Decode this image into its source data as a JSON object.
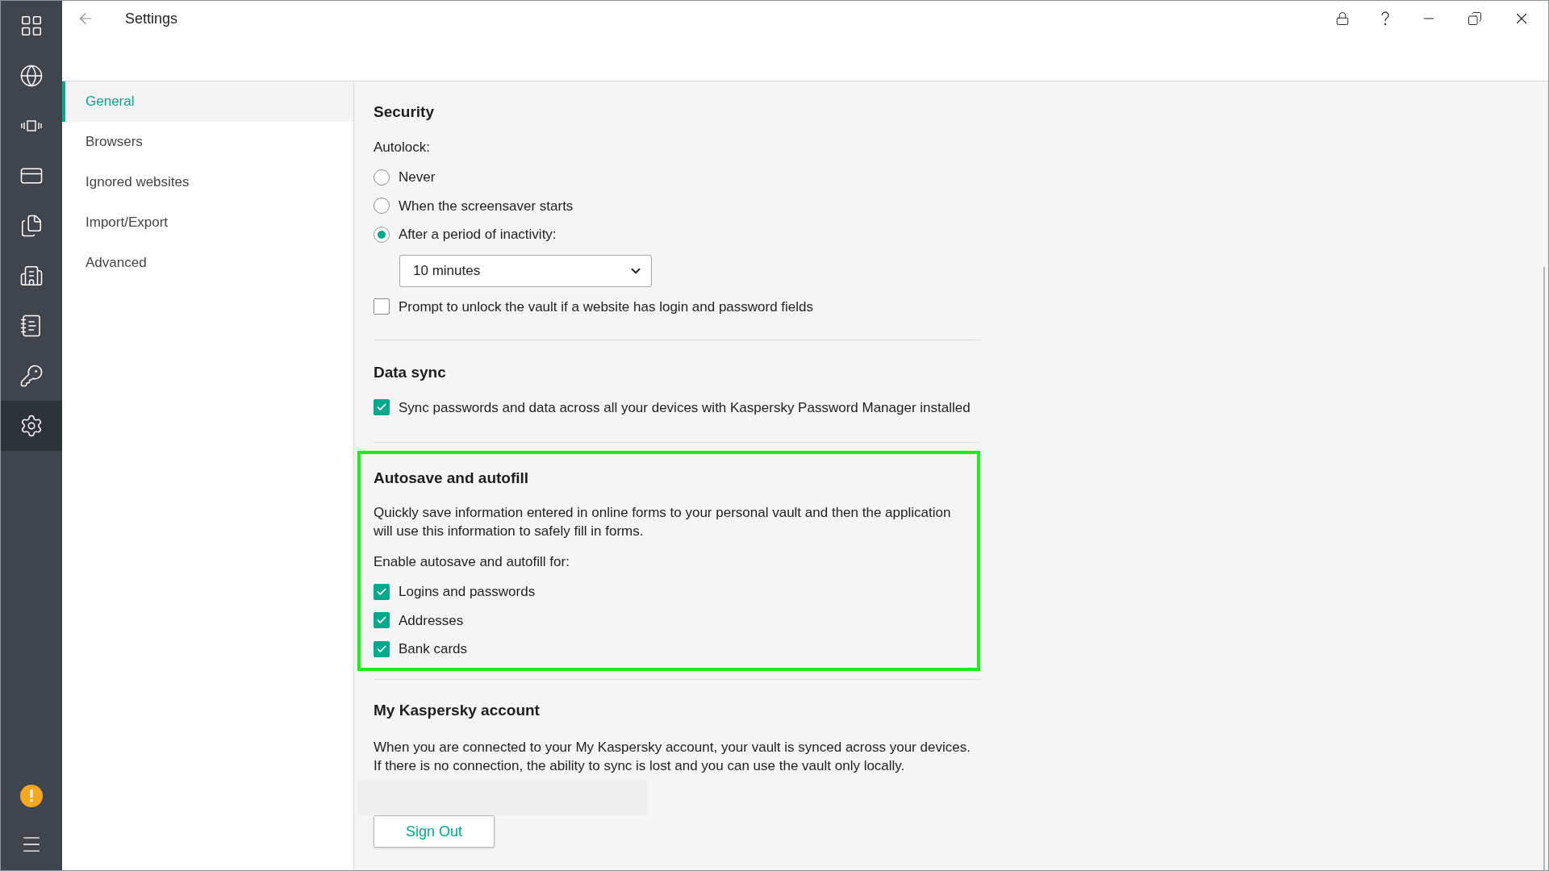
{
  "window": {
    "title": "Settings"
  },
  "rail_items": [
    {
      "kind": "dashboard",
      "selected": false
    },
    {
      "kind": "globe",
      "selected": false
    },
    {
      "kind": "vibrate",
      "selected": false
    },
    {
      "kind": "card",
      "selected": false
    },
    {
      "kind": "documents",
      "selected": false
    },
    {
      "kind": "building",
      "selected": false
    },
    {
      "kind": "notes",
      "selected": false
    },
    {
      "kind": "key",
      "selected": false
    },
    {
      "kind": "settings",
      "selected": true
    }
  ],
  "sidebar": {
    "items": [
      {
        "label": "General",
        "selected": true
      },
      {
        "label": "Browsers",
        "selected": false
      },
      {
        "label": "Ignored websites",
        "selected": false
      },
      {
        "label": "Import/Export",
        "selected": false
      },
      {
        "label": "Advanced",
        "selected": false
      }
    ]
  },
  "sections": [
    {
      "kind": "security",
      "title": "Security",
      "label": "Autolock:",
      "highlighted": false,
      "radios": [
        {
          "label": "Never",
          "selected": false
        },
        {
          "label": "When the screensaver starts",
          "selected": false
        },
        {
          "label": "After a period of inactivity:",
          "selected": true
        }
      ],
      "dropdown": {
        "value": "10 minutes"
      },
      "checkboxes": [
        {
          "label": "Prompt to unlock the vault if a website has login and password fields",
          "checked": false
        }
      ]
    },
    {
      "kind": "sync",
      "title": "Data sync",
      "highlighted": false,
      "checkboxes": [
        {
          "label": "Sync passwords and data across all your devices with Kaspersky Password Manager installed",
          "checked": true
        }
      ]
    },
    {
      "kind": "autofill",
      "title": "Autosave and autofill",
      "highlighted": true,
      "description": "Quickly save information entered in online forms to your personal vault and then the application will use this information to safely fill in forms.",
      "label": "Enable autosave and autofill for:",
      "checkboxes": [
        {
          "label": "Logins and passwords",
          "checked": true
        },
        {
          "label": "Addresses",
          "checked": true
        },
        {
          "label": "Bank cards",
          "checked": true
        }
      ]
    },
    {
      "kind": "account",
      "title": "My Kaspersky account",
      "highlighted": false,
      "description_lines": [
        "When you are connected to your My Kaspersky account, your vault is synced across your devices.",
        "If there is no connection, the ability to sync is lost and you can use the vault only locally."
      ],
      "button": "Sign Out"
    }
  ]
}
